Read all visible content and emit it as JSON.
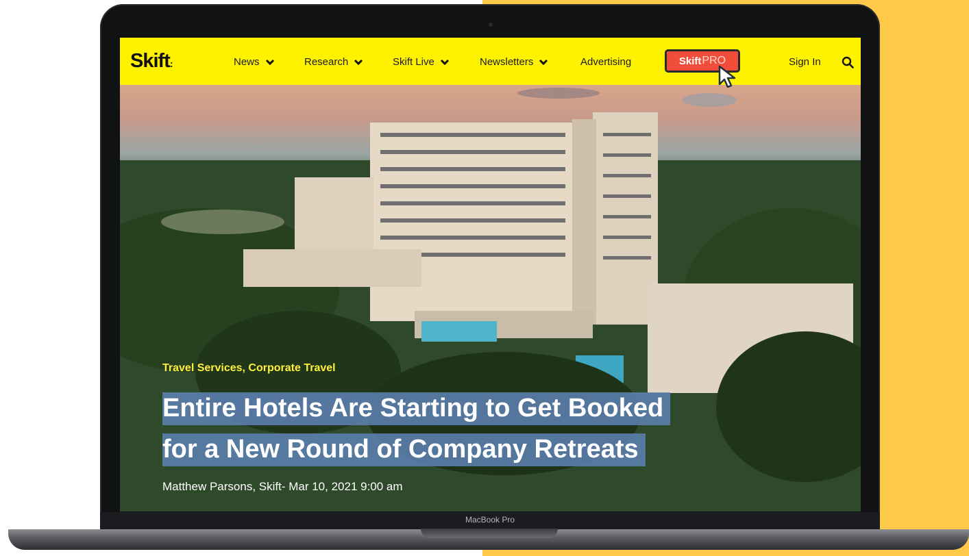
{
  "nav": {
    "logo": "Skift",
    "items": [
      {
        "label": "News"
      },
      {
        "label": "Research"
      },
      {
        "label": "Skift Live"
      },
      {
        "label": "Newsletters"
      },
      {
        "label": "Advertising"
      }
    ],
    "pro_button": {
      "brand": "Skift",
      "suffix": "PRO"
    },
    "sign_in": "Sign In"
  },
  "article": {
    "categories": "Travel Services, Corporate Travel",
    "headline_line1": "Entire Hotels Are Starting to Get Booked",
    "headline_line2": "for a New Round of Company Retreats",
    "byline": "Matthew Parsons, Skift- Mar 10, 2021 9:00 am"
  },
  "device": {
    "model": "MacBook Pro"
  },
  "colors": {
    "nav_bg": "#fff200",
    "pro_button": "#f04e3a",
    "category_text": "#ffef3a",
    "headline_highlight": "#5c80b0",
    "side_panel": "#ffc94a"
  }
}
